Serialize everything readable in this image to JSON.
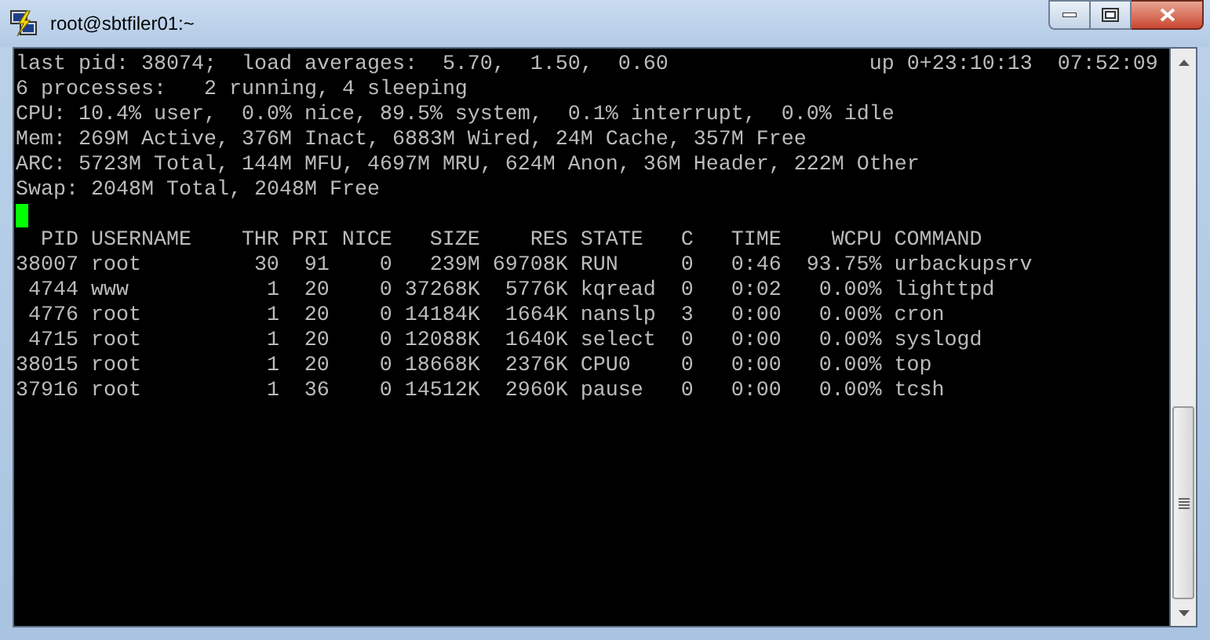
{
  "window": {
    "title": "root@sbtfiler01:~"
  },
  "summary_lines": [
    "last pid: 38074;  load averages:  5.70,  1.50,  0.60                up 0+23:10:13  07:52:09",
    "6 processes:   2 running, 4 sleeping",
    "CPU: 10.4% user,  0.0% nice, 89.5% system,  0.1% interrupt,  0.0% idle",
    "Mem: 269M Active, 376M Inact, 6883M Wired, 24M Cache, 357M Free",
    "ARC: 5723M Total, 144M MFU, 4697M MRU, 624M Anon, 36M Header, 222M Other",
    "Swap: 2048M Total, 2048M Free"
  ],
  "process_table": {
    "columns": [
      "PID",
      "USERNAME",
      "THR",
      "PRI",
      "NICE",
      "SIZE",
      "RES",
      "STATE",
      "C",
      "TIME",
      "WCPU",
      "COMMAND"
    ],
    "rows": [
      [
        "38007",
        "root",
        "30",
        "91",
        "0",
        "239M",
        "69708K",
        "RUN",
        "0",
        "0:46",
        "93.75%",
        "urbackupsrv"
      ],
      [
        "4744",
        "www",
        "1",
        "20",
        "0",
        "37268K",
        "5776K",
        "kqread",
        "0",
        "0:02",
        "0.00%",
        "lighttpd"
      ],
      [
        "4776",
        "root",
        "1",
        "20",
        "0",
        "14184K",
        "1664K",
        "nanslp",
        "3",
        "0:00",
        "0.00%",
        "cron"
      ],
      [
        "4715",
        "root",
        "1",
        "20",
        "0",
        "12088K",
        "1640K",
        "select",
        "0",
        "0:00",
        "0.00%",
        "syslogd"
      ],
      [
        "38015",
        "root",
        "1",
        "20",
        "0",
        "18668K",
        "2376K",
        "CPU0",
        "0",
        "0:00",
        "0.00%",
        "top"
      ],
      [
        "37916",
        "root",
        "1",
        "36",
        "0",
        "14512K",
        "2960K",
        "pause",
        "0",
        "0:00",
        "0.00%",
        "tcsh"
      ]
    ]
  }
}
